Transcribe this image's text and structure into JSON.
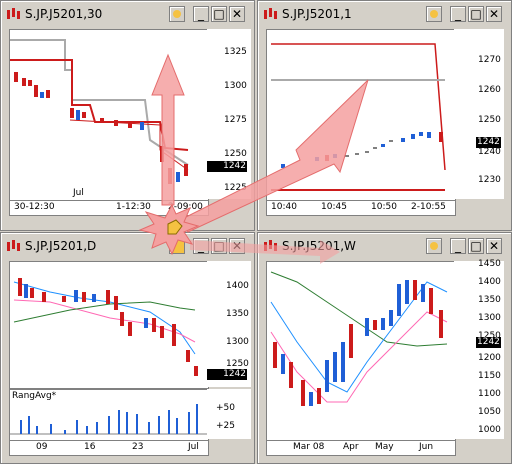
{
  "windows": [
    {
      "id": "w30",
      "title": "S.JP.J5201,30",
      "current_price": "1242",
      "price_labels": [
        "1325",
        "1300",
        "1275",
        "1250",
        "1225"
      ],
      "time_labels": [
        "30-12:30",
        "1-12:30",
        "2-09:00"
      ],
      "sub_label": "Jul"
    },
    {
      "id": "w1",
      "title": "S.JP.J5201,1",
      "current_price": "1242",
      "price_labels": [
        "1270",
        "1260",
        "1250",
        "1240",
        "1230"
      ],
      "time_labels": [
        "10:40",
        "10:45",
        "10:50",
        "2-10:55"
      ]
    },
    {
      "id": "wd",
      "title": "S.JP.J5201,D",
      "current_price": "1242",
      "price_labels": [
        "1400",
        "1350",
        "1300",
        "1250"
      ],
      "indicator_label": "RangAvg*",
      "indicator_labels": [
        "+50",
        "+25"
      ],
      "time_labels": [
        "09",
        "16",
        "23",
        "Jul"
      ]
    },
    {
      "id": "ww",
      "title": "S.JP.J5201,W",
      "current_price": "1242",
      "price_labels": [
        "1450",
        "1400",
        "1350",
        "1300",
        "1250",
        "1200",
        "1150",
        "1100",
        "1050",
        "1000"
      ],
      "time_labels": [
        "Mar 08",
        "Apr",
        "May",
        "Jun"
      ]
    }
  ],
  "colors": {
    "up": "#1f5fd6",
    "down": "#cc1b1b",
    "ma_red": "#cc1b1b",
    "ma_gray": "#aaaaaa",
    "arrow": "#f4a0a0"
  }
}
